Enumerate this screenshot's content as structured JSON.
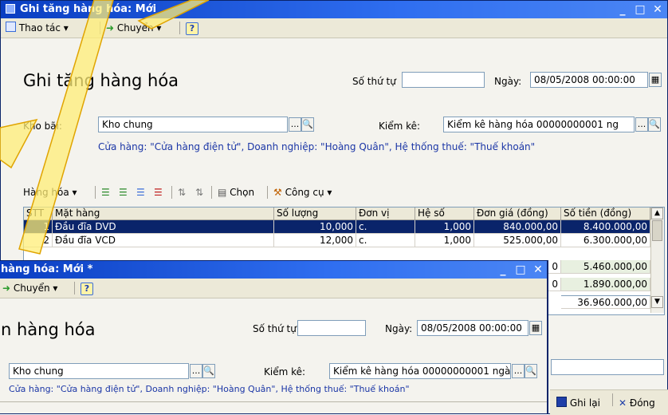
{
  "back_window": {
    "title": "Ghi tăng hàng hóa: Mới",
    "toolbar": {
      "actions_label": "Thao tác",
      "transfer_label": "Chuyển",
      "help_label": "?"
    },
    "heading": "Ghi tăng hàng hóa",
    "seq_label": "Số thứ tự",
    "seq_value": "",
    "date_label": "Ngày:",
    "date_value": "08/05/2008 00:00:00",
    "warehouse_label": "Kho bãi:",
    "warehouse_value": "Kho chung",
    "inventory_label": "Kiểm kê:",
    "inventory_value": "Kiểm kê hàng hóa 00000000001 ng",
    "store_note": "Cửa hàng: \"Cửa hàng điện tử\", Doanh nghiệp: \"Hoàng Quân\", Hệ thống thuế: \"Thuế khoán\"",
    "grid_toolbar": {
      "goods_label": "Hàng hóa",
      "choose_label": "Chọn",
      "tools_label": "Công cụ"
    },
    "columns": [
      "STT",
      "Mặt hàng",
      "Số lượng",
      "Đơn vị",
      "Hệ số",
      "Đơn giá (đồng)",
      "Số tiền (đồng)"
    ],
    "rows": [
      {
        "stt": "1",
        "item": "Đầu đĩa DVD",
        "qty": "10,000",
        "unit": "c.",
        "factor": "1,000",
        "price": "840.000,00",
        "amount": "8.400.000,00"
      },
      {
        "stt": "2",
        "item": "Đầu đĩa VCD",
        "qty": "12,000",
        "unit": "c.",
        "factor": "1,000",
        "price": "525.000,00",
        "amount": "6.300.000,00"
      }
    ],
    "partial_rows": [
      {
        "price_tail": "0",
        "amount": "5.460.000,00"
      },
      {
        "price_tail": "0",
        "amount": "1.890.000,00"
      }
    ],
    "total": "36.960.000,00",
    "save_label": "Ghi lại",
    "close_label": "Đóng"
  },
  "front_window": {
    "title": "hàng hóa: Mới *",
    "toolbar": {
      "transfer_label": "Chuyển",
      "help_label": "?"
    },
    "heading": "n hàng hóa",
    "seq_label": "Số thứ tự",
    "seq_value": "",
    "date_label": "Ngày:",
    "date_value": "08/05/2008 00:00:00",
    "warehouse_value": "Kho chung",
    "inventory_label": "Kiểm kê:",
    "inventory_value": "Kiểm kê hàng hóa 00000000001 ngà",
    "store_note": "Cửa hàng: \"Cửa hàng điện tử\", Doanh nghiệp: \"Hoàng Quân\", Hệ thống thuế: \"Thuế khoán\""
  },
  "colors": {
    "title_bar": "#0a3ec2",
    "selection": "#0a246a",
    "note_text": "#1b36a6",
    "arrow_fill": "#ffee77",
    "arrow_stroke": "#e0a400"
  }
}
